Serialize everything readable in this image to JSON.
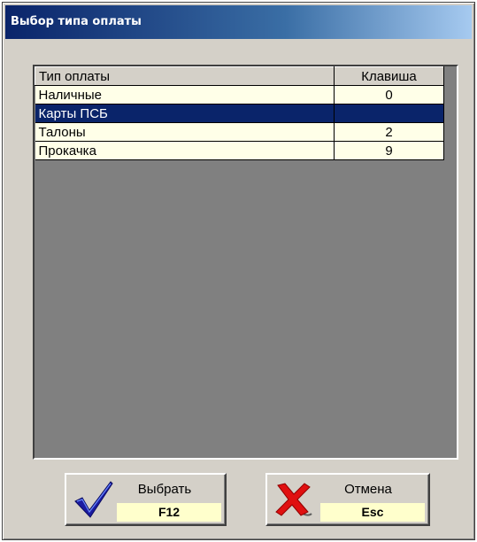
{
  "window": {
    "title": "Выбор типа оплаты"
  },
  "grid": {
    "columns": {
      "type": "Тип оплаты",
      "key": "Клавиша"
    },
    "rows": [
      {
        "type": "Наличные",
        "key": "0",
        "selected": false
      },
      {
        "type": "Карты ПСБ",
        "key": "",
        "selected": true
      },
      {
        "type": "Талоны",
        "key": "2",
        "selected": false
      },
      {
        "type": "Прокачка",
        "key": "9",
        "selected": false
      }
    ]
  },
  "buttons": {
    "ok": {
      "label": "Выбрать",
      "hotkey": "F12",
      "icon": "checkmark-icon"
    },
    "cancel": {
      "label": "Отмена",
      "hotkey": "Esc",
      "icon": "cross-icon"
    }
  },
  "colors": {
    "title_bar": "#0a246a",
    "selected_row": "#0a246a",
    "row_background": "#ffffe8",
    "hotkey_background": "#ffffcc",
    "grid_empty_area": "#808080"
  }
}
